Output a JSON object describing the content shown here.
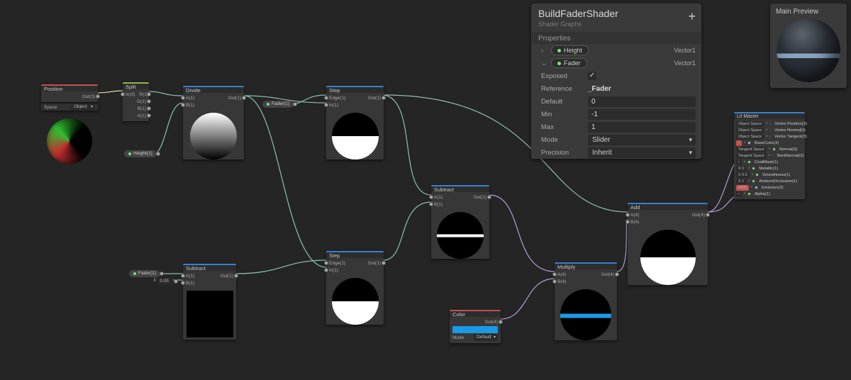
{
  "inspector": {
    "title": "BuildFaderShader",
    "subtitle": "Shader Graphs",
    "section": "Properties",
    "prop_height": {
      "label": "Height",
      "type": "Vector1"
    },
    "prop_fader": {
      "label": "Fader",
      "type": "Vector1"
    },
    "rows": {
      "exposed": {
        "k": "Exposed",
        "v": "✓"
      },
      "reference": {
        "k": "Reference",
        "v": "_Fader"
      },
      "default": {
        "k": "Default",
        "v": "0"
      },
      "min": {
        "k": "Min",
        "v": "-1"
      },
      "max": {
        "k": "Max",
        "v": "1"
      },
      "mode": {
        "k": "Mode",
        "v": "Slider"
      },
      "precision": {
        "k": "Precision",
        "v": "Inherit"
      }
    }
  },
  "mainPreview": {
    "title": "Main Preview"
  },
  "nodes": {
    "position": {
      "title": "Position",
      "out": "Out(3)",
      "space_label": "Space",
      "space_value": "Object"
    },
    "split": {
      "title": "Split",
      "in": "In(3)",
      "r": "R(1)",
      "g": "G(1)",
      "b": "B(1)",
      "a": "A(1)"
    },
    "divide": {
      "title": "Divide",
      "a": "A(1)",
      "b": "B(1)",
      "out": "Out(1)"
    },
    "height": {
      "label": "Height(1)"
    },
    "faderA": {
      "label": "Fader(1)"
    },
    "faderB": {
      "label": "Fader(1)"
    },
    "xconst": {
      "label": "X",
      "val": "0.05"
    },
    "step1": {
      "title": "Step",
      "edge": "Edge(1)",
      "in": "In(1)",
      "out": "Out(1)"
    },
    "step2": {
      "title": "Step",
      "edge": "Edge(1)",
      "in": "In(1)",
      "out": "Out(1)"
    },
    "subtractA": {
      "title": "Subtract",
      "a": "A(1)",
      "b": "B(1)",
      "out": "Out(1)"
    },
    "subtractMid": {
      "title": "Subtract",
      "a": "A(1)",
      "b": "B(1)",
      "out": "Out(1)"
    },
    "color": {
      "title": "Color",
      "out": "Out(4)",
      "mode_label": "Mode",
      "mode_value": "Default"
    },
    "multiply": {
      "title": "Multiply",
      "a": "A(4)",
      "b": "B(4)",
      "out": "Out(4)"
    },
    "add": {
      "title": "Add",
      "a": "A(4)",
      "b": "B(4)",
      "out": "Out(4)"
    },
    "master": {
      "title": "Lit Master",
      "rows": [
        {
          "tag": "Object Space",
          "lbl": "Vertex Position(3)"
        },
        {
          "tag": "Object Space",
          "lbl": "Vertex Normal(3)"
        },
        {
          "tag": "Object Space",
          "lbl": "Vertex Tangent(3)"
        },
        {
          "tag": "",
          "lbl": "BaseColor(3)",
          "hl": true
        },
        {
          "tag": "Tangent Space",
          "lbl": "Normal(3)"
        },
        {
          "tag": "Tangent Space",
          "lbl": "BentNormal(3)"
        },
        {
          "tag": "",
          "lbl": "CoatMask(1)"
        },
        {
          "tag": "X  0",
          "lbl": "Metallic(1)"
        },
        {
          "tag": "X  0.5",
          "lbl": "Smoothness(1)"
        },
        {
          "tag": "X  1",
          "lbl": "AmbientOcclusion(1)"
        },
        {
          "tag": "HDR",
          "lbl": "Emission(3)",
          "hl": true
        },
        {
          "tag": "",
          "lbl": "Alpha(1)"
        }
      ]
    }
  }
}
